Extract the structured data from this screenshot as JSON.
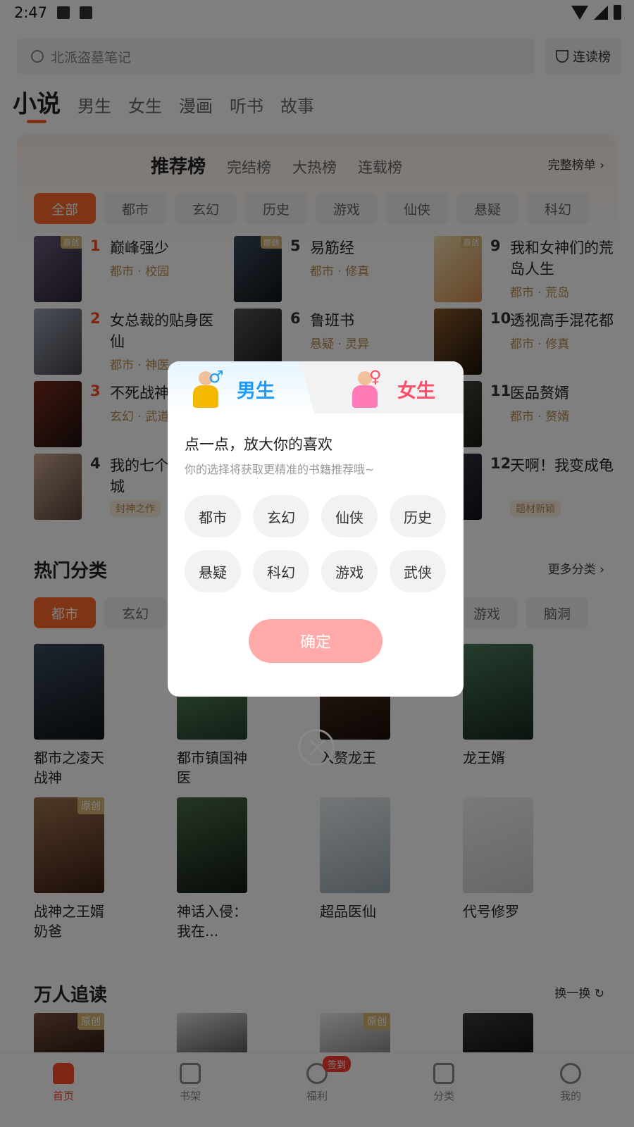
{
  "status": {
    "time": "2:47"
  },
  "search": {
    "placeholder": "北派盗墓笔记",
    "rank_label": "连读榜"
  },
  "top_tabs": [
    "小说",
    "男生",
    "女生",
    "漫画",
    "听书",
    "故事"
  ],
  "rank": {
    "tabs": [
      "推荐榜",
      "完结榜",
      "大热榜",
      "连载榜"
    ],
    "full_list": "完整榜单",
    "chips": [
      "全部",
      "都市",
      "玄幻",
      "历史",
      "游戏",
      "仙侠",
      "悬疑",
      "科幻"
    ],
    "items": [
      {
        "no": "1",
        "title": "巅峰强少",
        "meta": "都市 · 校园",
        "tag": "原创"
      },
      {
        "no": "2",
        "title": "女总裁的贴身医仙",
        "meta": "都市 · 神医",
        "tag": ""
      },
      {
        "no": "3",
        "title": "不死战神",
        "meta": "玄幻 · 武道",
        "tag": ""
      },
      {
        "no": "4",
        "title": "我的七个绝色倾城",
        "meta": "",
        "badge": "封神之作",
        "tag": ""
      },
      {
        "no": "5",
        "title": "易筋经",
        "meta": "都市 · 修真",
        "tag": "原创"
      },
      {
        "no": "6",
        "title": "鲁班书",
        "meta": "悬疑 · 灵异",
        "tag": ""
      },
      {
        "no": "9",
        "title": "我和女神们的荒岛人生",
        "meta": "都市 · 荒岛",
        "tag": "原创"
      },
      {
        "no": "10",
        "title": "透视高手混花都",
        "meta": "都市 · 修真",
        "tag": ""
      },
      {
        "no": "11",
        "title": "医品赘婿",
        "meta": "都市 · 赘婿",
        "tag": ""
      },
      {
        "no": "12",
        "title": "天啊！我变成龟",
        "meta": "",
        "badge": "题材新颖",
        "tag": ""
      }
    ]
  },
  "hot": {
    "title": "热门分类",
    "more": "更多分类",
    "chips": [
      "都市",
      "玄幻",
      "游戏",
      "脑洞"
    ],
    "books": [
      {
        "title": "都市之凌天战神",
        "tag": ""
      },
      {
        "title": "都市镇国神医",
        "tag": ""
      },
      {
        "title": "入赘龙王",
        "tag": ""
      },
      {
        "title": "龙王婿",
        "tag": ""
      },
      {
        "title": "战神之王婿奶爸",
        "tag": "原创"
      },
      {
        "title": "神话入侵：我在...",
        "tag": ""
      },
      {
        "title": "超品医仙",
        "tag": ""
      },
      {
        "title": "代号修罗",
        "tag": ""
      }
    ]
  },
  "popular": {
    "title": "万人追读",
    "refresh": "换一换",
    "tags": [
      "原创",
      "原创"
    ]
  },
  "nav": {
    "items": [
      "首页",
      "书架",
      "福利",
      "分类",
      "我的"
    ],
    "badge": "签到"
  },
  "dialog": {
    "male": "男生",
    "female": "女生",
    "male_symbol": "♂",
    "female_symbol": "♀",
    "title": "点一点，放大你的喜欢",
    "subtitle": "你的选择将获取更精准的书籍推荐哦~",
    "prefs": [
      "都市",
      "玄幻",
      "仙侠",
      "历史",
      "悬疑",
      "科幻",
      "游戏",
      "武侠"
    ],
    "confirm": "确定"
  }
}
